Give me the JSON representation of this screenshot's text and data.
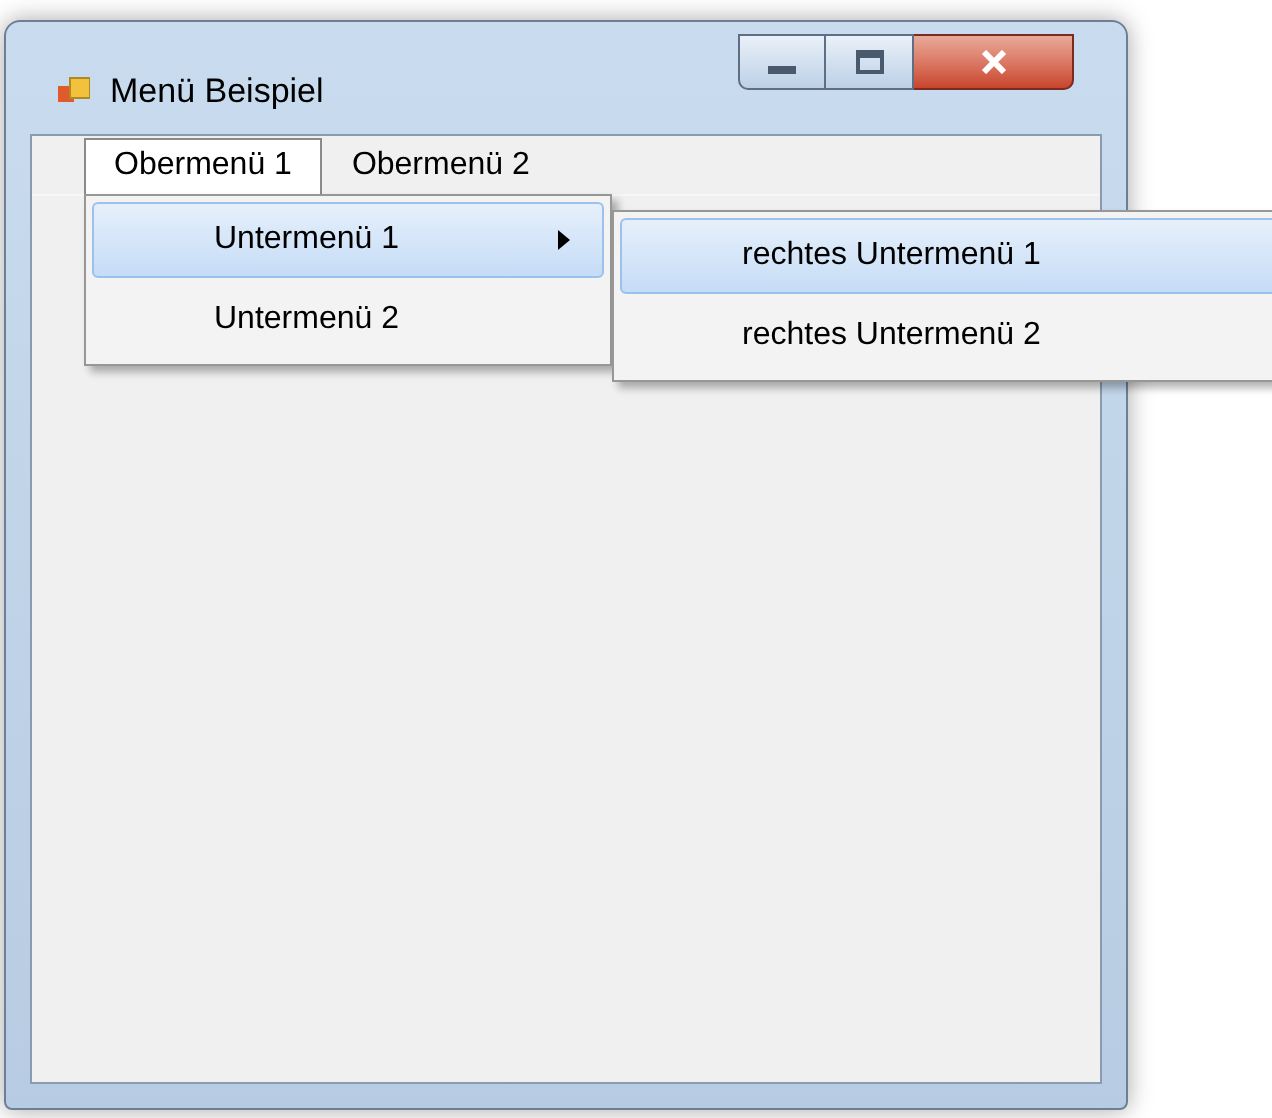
{
  "window": {
    "title": "Menü Beispiel"
  },
  "menu_bar": [
    {
      "label": "Obermenü 1",
      "selected": true
    },
    {
      "label": "Obermenü 2",
      "selected": false
    }
  ],
  "dropdown": [
    {
      "label": "Untermenü 1",
      "selected": true,
      "has_submenu": true
    },
    {
      "label": "Untermenü 2",
      "selected": false,
      "has_submenu": false
    }
  ],
  "submenu": [
    {
      "label": "rechtes Untermenü 1",
      "selected": true
    },
    {
      "label": "rechtes Untermenü 2",
      "selected": false
    }
  ]
}
